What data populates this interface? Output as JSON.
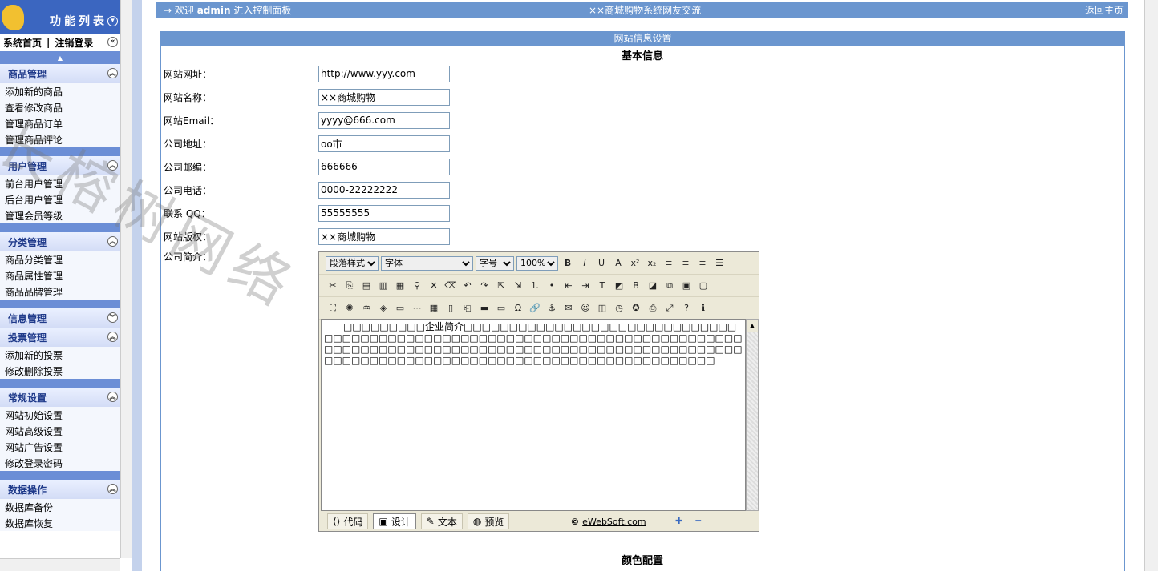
{
  "sidebar": {
    "title": "功能列表",
    "top_links": [
      "系统首页",
      "注销登录"
    ],
    "groups": [
      {
        "label": "商品管理",
        "items": [
          "添加新的商品",
          "查看修改商品",
          "管理商品订单",
          "管理商品评论"
        ]
      },
      {
        "label": "用户管理",
        "items": [
          "前台用户管理",
          "后台用户管理",
          "管理会员等级"
        ]
      },
      {
        "label": "分类管理",
        "items": [
          "商品分类管理",
          "商品属性管理",
          "商品品牌管理"
        ]
      },
      {
        "label": "信息管理",
        "items": []
      },
      {
        "label": "投票管理",
        "items": [
          "添加新的投票",
          "修改删除投票"
        ]
      },
      {
        "label": "常规设置",
        "items": [
          "网站初始设置",
          "网站高级设置",
          "网站广告设置",
          "修改登录密码"
        ]
      },
      {
        "label": "数据操作",
        "items": [
          "数据库备份",
          "数据库恢复"
        ]
      }
    ]
  },
  "welcome": {
    "prefix": "→ 欢迎",
    "user": "admin",
    "suffix": "进入控制面板",
    "center": "××商城购物系统网友交流",
    "right": "返回主页"
  },
  "panel": {
    "title": "网站信息设置",
    "section1": "基本信息",
    "section2": "颜色配置"
  },
  "fields": [
    {
      "label": "网站网址：",
      "value": "http://www.yyy.com"
    },
    {
      "label": "网站名称：",
      "value": "××商城购物"
    },
    {
      "label": "网站Email：",
      "value": "yyyy@666.com"
    },
    {
      "label": "公司地址：",
      "value": "oo市"
    },
    {
      "label": "公司邮编：",
      "value": "666666"
    },
    {
      "label": "公司电话：",
      "value": "0000-22222222"
    },
    {
      "label": "联系 QQ：",
      "value": "55555555"
    },
    {
      "label": "网站版权：",
      "value": "××商城购物"
    }
  ],
  "intro_label": "公司简介：",
  "editor": {
    "style_select": "段落样式",
    "font_select": "字体",
    "size_select": "字号",
    "zoom_select": "100%",
    "content": "　　□□□□□□□□□企业简介□□□□□□□□□□□□□□□□□□□□□□□□□□□□□□□□□□□□□□□□□□□□□□□□□□□□□□□□□□□□□□□□□□□□□□□□□□□□□□□□□□□□□□□□□□□□□□□□□□□□□□□□□□□□□□□□□□□□□□□□□□□□□□□□□□□□□□□□□□□□□□□□□□□□□□□□□□□□□□□□□□□□□",
    "modes": [
      "代码",
      "设计",
      "文本",
      "预览"
    ],
    "copyright_prefix": "© ",
    "copyright_link": "eWebSoft.com"
  },
  "watermark": "长榕树网络"
}
